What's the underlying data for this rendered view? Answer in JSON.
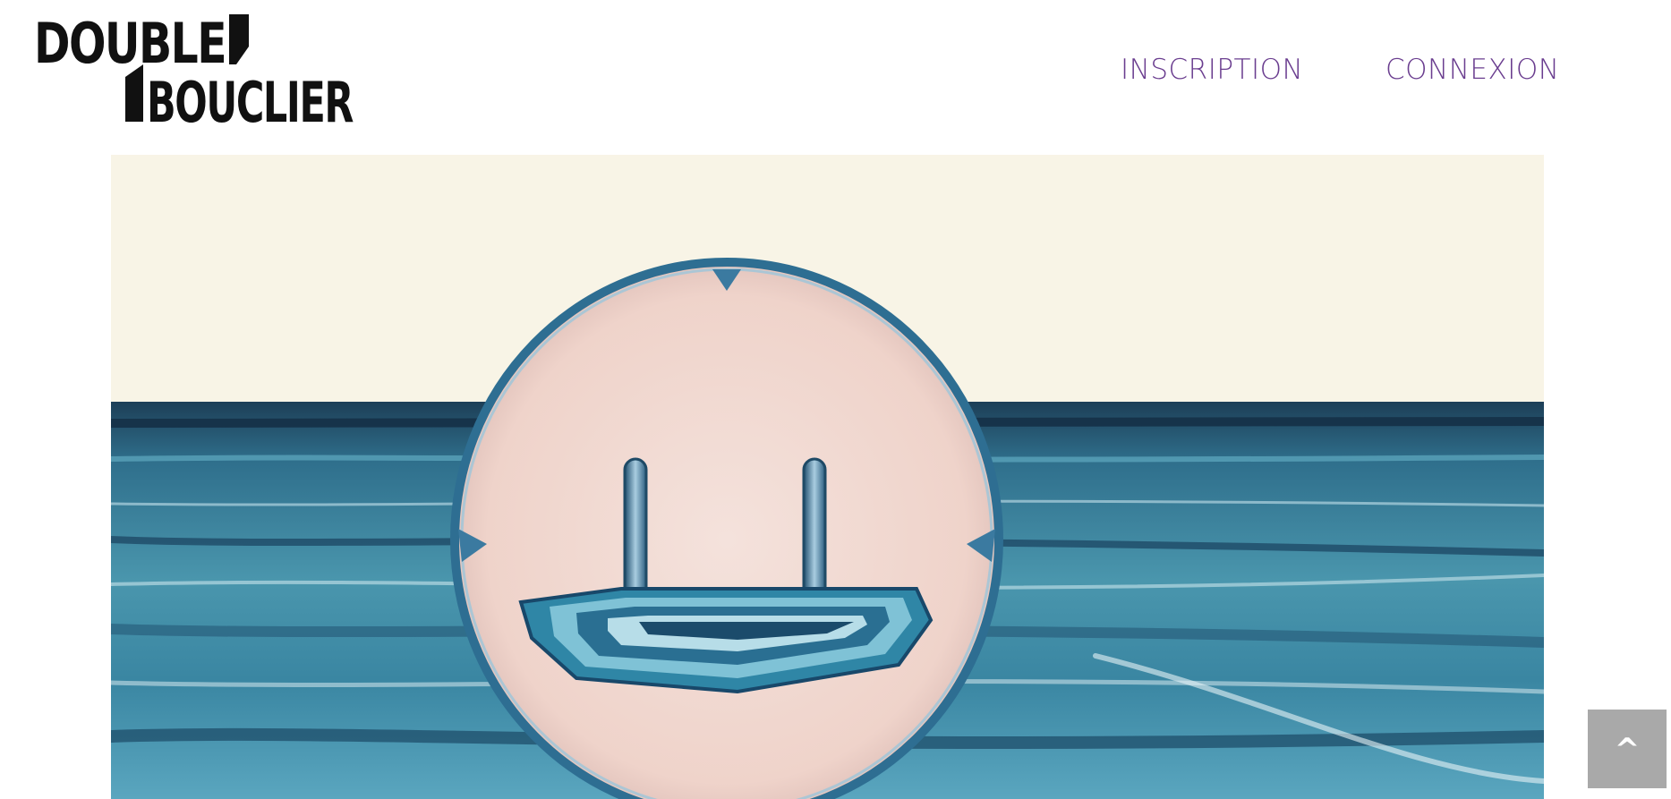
{
  "brand": {
    "logo_line1": "DOUBLE",
    "logo_line2": "BOUCLIER"
  },
  "nav": {
    "items": [
      {
        "label": "INSCRIPTION"
      },
      {
        "label": "CONNEXION"
      }
    ]
  },
  "back_to_top": {
    "label": "^"
  },
  "colors": {
    "nav_text": "#6a3d8f",
    "sky": "#f8f4e6",
    "sea": "#2f7a94",
    "disc": "#f0d6cf",
    "back_to_top_bg": "#a9a9a9"
  }
}
